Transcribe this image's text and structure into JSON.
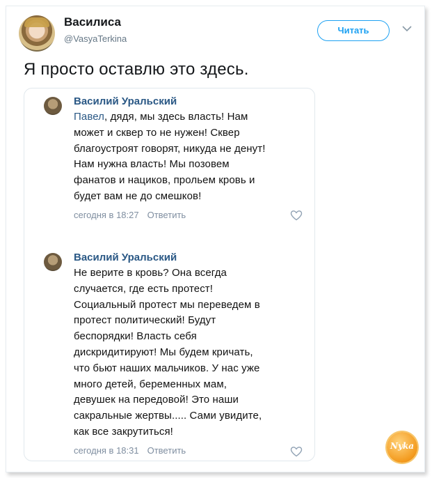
{
  "user": {
    "name": "Василиса",
    "handle": "@VasyaTerkina"
  },
  "follow_label": "Читать",
  "tweet_text": "Я просто оставлю это здесь.",
  "comments": [
    {
      "author": "Василий Уральский",
      "mention": "Павел",
      "text_after_mention": ", дядя, мы здесь власть! Нам",
      "lines": [
        "может и сквер то не нужен! Сквер",
        "благоустроят говорят, никуда не денут!",
        "Нам нужна власть! Мы позовем",
        "фанатов и нациков, прольем кровь и",
        "будет вам не до смешков!"
      ],
      "time": "сегодня в 18:27",
      "reply": "Ответить"
    },
    {
      "author": "Василий Уральский",
      "lines": [
        "Не верите в кровь? Она всегда",
        "случается, где есть протест!",
        "Социальный протест мы переведем в",
        "протест политический! Будут",
        "беспорядки! Власть себя",
        "дискридитируют! Мы будем кричать,",
        "что бьют наших мальчиков. У нас уже",
        "много детей, беременных мам,",
        "девушек на передовой! Это наши",
        "сакральные жертвы..... Сами увидите,",
        "как все закрутиться!"
      ],
      "time": "сегодня в 18:31",
      "reply": "Ответить"
    }
  ],
  "watermark": "Nyka",
  "icons": {
    "more": "chevron-down-icon",
    "like": "heart-icon"
  },
  "colors": {
    "accent": "#1da1f2",
    "link": "#2a5885",
    "meta": "#7f8ea0"
  }
}
